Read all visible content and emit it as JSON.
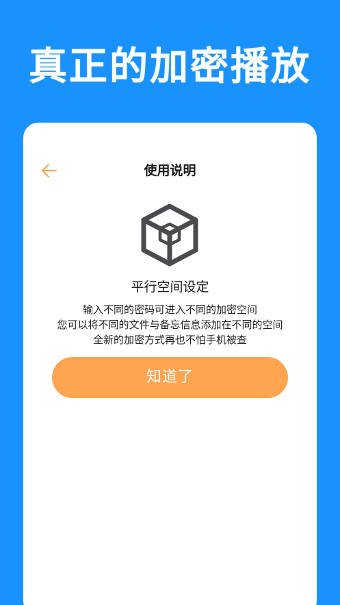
{
  "promo": {
    "title": "真正的加密播放"
  },
  "header": {
    "title": "使用说明",
    "back_icon": "arrow-left-icon"
  },
  "content": {
    "icon": "cube-icon",
    "title": "平行空间设定",
    "lines": [
      "输入不同的密码可进入不同的加密空间",
      "您可以将不同的文件与备忘信息添加在不同的空间",
      "全新的加密方式再也不怕手机被查"
    ]
  },
  "actions": {
    "confirm_label": "知道了"
  },
  "colors": {
    "background": "#1a92fd",
    "accent": "#ffa552",
    "icon": "#4a4a4f"
  }
}
